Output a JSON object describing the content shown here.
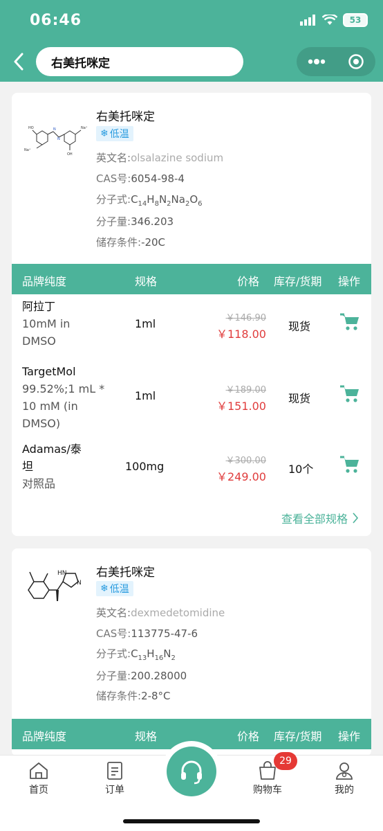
{
  "status": {
    "time": "06:46",
    "battery": "53"
  },
  "header": {
    "search_text": "右美托咪定"
  },
  "colors": {
    "primary": "#4cb39a",
    "price_red": "#e03c3c",
    "cold_badge": "#2b9cdf"
  },
  "products": [
    {
      "name": "右美托咪定",
      "storage_badge": "低温",
      "attrs": [
        {
          "key": "英文名:",
          "value": "olsalazine sodium"
        },
        {
          "key": "CAS号:",
          "value": "6054-98-4"
        },
        {
          "key": "分子式:",
          "value": "C14H8N2Na2O6"
        },
        {
          "key": "分子量:",
          "value": "346.203"
        },
        {
          "key": "储存条件:",
          "value": "-20C"
        }
      ],
      "table_headers": [
        "品牌纯度",
        "规格",
        "价格",
        "库存/货期",
        "操作"
      ],
      "rows": [
        {
          "brand": "阿拉丁",
          "purity": "10mM in DMSO",
          "spec": "1ml",
          "old_price": "￥146.90",
          "price": "￥118.00",
          "stock": "现货"
        },
        {
          "brand": "TargetMol",
          "purity": "99.52%;1 mL * 10 mM (in DMSO)",
          "spec": "1ml",
          "old_price": "￥189.00",
          "price": "￥151.00",
          "stock": "现货"
        },
        {
          "brand": "Adamas/泰坦",
          "purity": "对照品",
          "spec": "100mg",
          "old_price": "￥300.00",
          "price": "￥249.00",
          "stock": "10个"
        }
      ],
      "view_all": "查看全部规格"
    },
    {
      "name": "右美托咪定",
      "storage_badge": "低温",
      "attrs": [
        {
          "key": "英文名:",
          "value": "dexmedetomidine"
        },
        {
          "key": "CAS号:",
          "value": "113775-47-6"
        },
        {
          "key": "分子式:",
          "value": "C13H16N2"
        },
        {
          "key": "分子量:",
          "value": "200.28000"
        },
        {
          "key": "储存条件:",
          "value": "2-8°C"
        }
      ],
      "table_headers": [
        "品牌纯度",
        "规格",
        "价格",
        "库存/货期",
        "操作"
      ]
    }
  ],
  "nav": {
    "home": "首页",
    "orders": "订单",
    "cart": "购物车",
    "cart_count": "29",
    "mine": "我的"
  }
}
